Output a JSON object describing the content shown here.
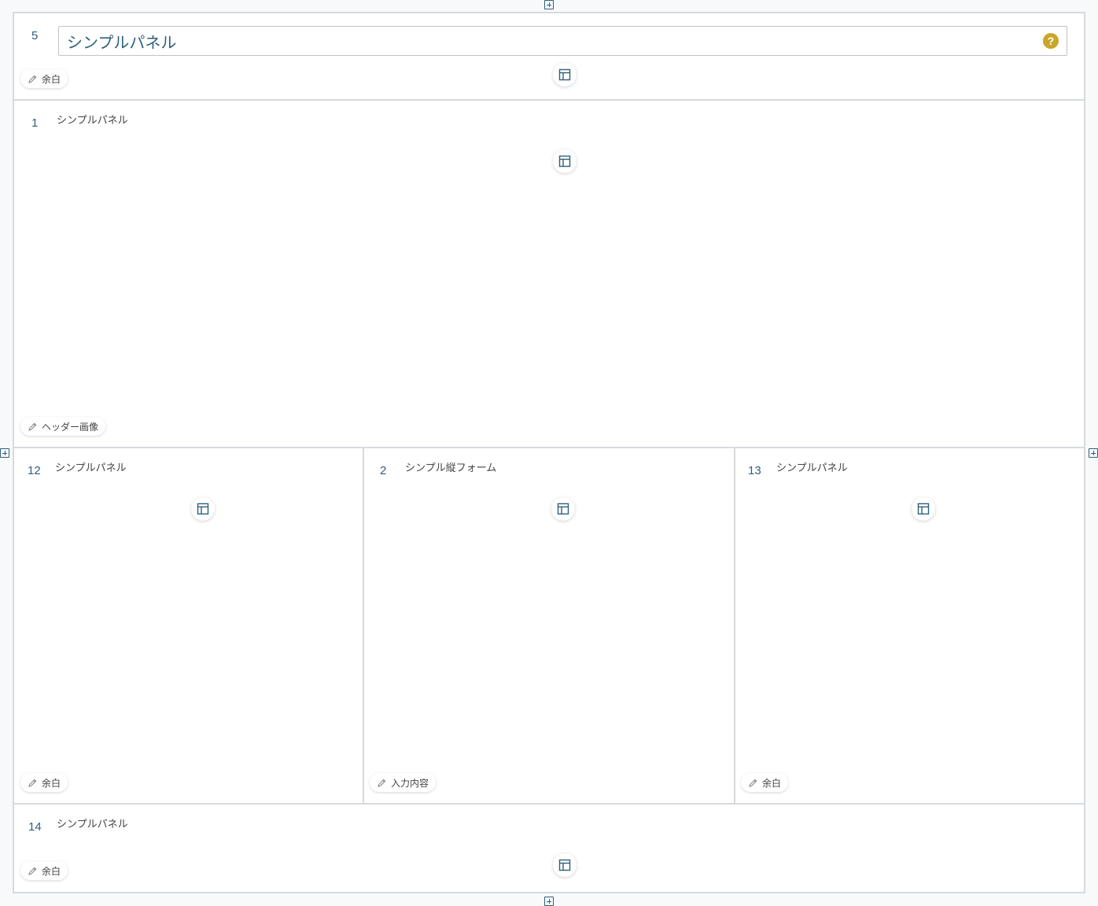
{
  "header_panel": {
    "number": "5",
    "title_value": "シンプルパネル",
    "help_label": "?",
    "chip_label": "余白"
  },
  "panel_1": {
    "number": "1",
    "title": "シンプルパネル",
    "chip_label": "ヘッダー画像"
  },
  "panel_12": {
    "number": "12",
    "title": "シンプルパネル",
    "chip_label": "余白"
  },
  "panel_2": {
    "number": "2",
    "title": "シンプル縦フォーム",
    "chip_label": "入力内容"
  },
  "panel_13": {
    "number": "13",
    "title": "シンプルパネル",
    "chip_label": "余白"
  },
  "panel_14": {
    "number": "14",
    "title": "シンプルパネル",
    "chip_label": "余白"
  },
  "icons": {
    "layout": "layout-icon",
    "edit": "pencil-icon",
    "help": "help-icon",
    "add": "add-box-icon"
  },
  "colors": {
    "accent": "#2f5f7c",
    "help": "#c9a62a",
    "border": "#d7dadd"
  }
}
